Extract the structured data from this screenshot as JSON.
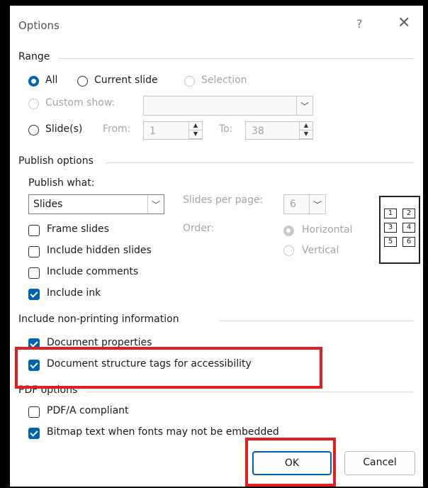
{
  "dialog": {
    "title": "Options",
    "help_glyph": "?",
    "close_glyph": "✕"
  },
  "range": {
    "label": "Range",
    "all": "All",
    "current_slide": "Current slide",
    "selection": "Selection",
    "custom_show": "Custom show:",
    "slides": "Slide(s)",
    "from_label": "From:",
    "from_value": "1",
    "to_label": "To:",
    "to_value": "38"
  },
  "publish": {
    "label": "Publish options",
    "what_label": "Publish what:",
    "what_value": "Slides",
    "slides_per_page_label": "Slides per page:",
    "slides_per_page_value": "6",
    "order_label": "Order:",
    "horizontal": "Horizontal",
    "vertical": "Vertical",
    "frame_slides": "Frame slides",
    "include_hidden": "Include hidden slides",
    "include_comments": "Include comments",
    "include_ink": "Include ink",
    "grid_numbers": [
      "1",
      "2",
      "3",
      "4",
      "5",
      "6"
    ]
  },
  "nonprinting": {
    "label": "Include non-printing information",
    "doc_properties": "Document properties",
    "doc_structure": "Document structure tags for accessibility"
  },
  "pdf": {
    "label": "PDF options",
    "pdfa": "PDF/A compliant",
    "bitmap": "Bitmap text when fonts may not be embedded"
  },
  "buttons": {
    "ok": "OK",
    "cancel": "Cancel"
  },
  "colors": {
    "accent": "#0063b1",
    "highlight": "#e02020"
  }
}
